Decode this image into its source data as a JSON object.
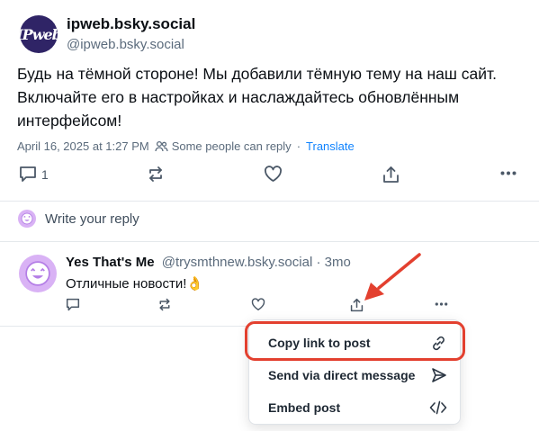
{
  "post": {
    "author_display_name": "ipweb.bsky.social",
    "author_handle": "@ipweb.bsky.social",
    "avatar_text": "IPweb",
    "text": "Будь на тёмной стороне! Мы добавили тёмную тему на наш сайт. Включайте его в настройках и наслаждайтесь обновлённым интерфейсом!",
    "timestamp": "April 16, 2025 at 1:27 PM",
    "reply_permission": "Some people can reply",
    "separator": "·",
    "translate_label": "Translate",
    "reply_count": "1",
    "icons": [
      "reply-icon",
      "repost-icon",
      "like-icon",
      "share-icon",
      "more-icon",
      "people-icon"
    ]
  },
  "reply_box": {
    "placeholder": "Write your reply",
    "avatar_icon": "smiley-avatar-icon"
  },
  "reply": {
    "author_display_name": "Yes That's Me",
    "author_handle": "@trysmthnew.bsky.social · 3mo",
    "text": "Отличные новости!👌",
    "avatar_icon": "smiley-avatar-icon"
  },
  "share_menu": {
    "items": [
      {
        "label": "Copy link to post",
        "icon": "link-icon"
      },
      {
        "label": "Send via direct message",
        "icon": "send-icon"
      },
      {
        "label": "Embed post",
        "icon": "code-icon"
      }
    ]
  },
  "colors": {
    "text_primary": "#0b0f14",
    "text_secondary": "#5b6b7c",
    "link": "#1083fe",
    "avatar_purple": "#d9b2f5",
    "annotation_red": "#e3402f"
  }
}
